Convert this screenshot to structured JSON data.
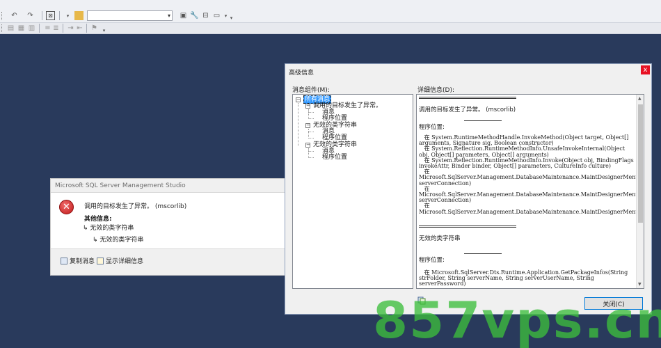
{
  "colors": {
    "background": "#293a5c",
    "error_red": "#c11a1a",
    "selection": "#3399ff",
    "watermark": "#3cbe3c"
  },
  "toolbar": {
    "row1_icons": [
      "undo-icon",
      "redo-icon",
      "find-icon",
      "dropdown-icon",
      "folder-icon",
      "properties-icon",
      "wrench-icon",
      "toolbox-icon",
      "window-icon"
    ],
    "combo_value": "",
    "row2_icons": [
      "comment-icon",
      "uncomment-icon",
      "indent-icon",
      "outdent-icon",
      "bookmark-icon"
    ]
  },
  "msgbox": {
    "title": "Microsoft SQL Server Management Studio",
    "message": "调用的目标发生了异常。 (mscorlib)",
    "other_info_label": "其他信息:",
    "line1": "无效的类字符串",
    "line2": "无效的类字符串",
    "copy_link": "复制消息",
    "details_link": "显示详细信息"
  },
  "advanced": {
    "title": "高级信息",
    "tree_label": "消息组件(M):",
    "detail_label": "详细信息(D):",
    "tree": {
      "root": "所有消息",
      "group1": "调用的目标发生了异常。",
      "group1_msg": "消息",
      "group1_loc": "程序位置",
      "group2": "无效的类字符串",
      "group2_msg": "消息",
      "group2_loc": "程序位置",
      "group3": "无效的类字符串",
      "group3_msg": "消息",
      "group3_loc": "程序位置"
    },
    "detail": {
      "message1": "调用的目标发生了异常。 (mscorlib)",
      "location_label": "程序位置:",
      "stack1": "   在 System.RuntimeMethodHandle.InvokeMethod(Object target, Object[] arguments, Signature sig, Boolean constructor)\n   在 System.Reflection.RuntimeMethodInfo.UnsafeInvokeInternal(Object obj, Object[] parameters, Object[] arguments)\n   在 System.Reflection.RuntimeMethodInfo.Invoke(Object obj, BindingFlags invokeAttr, Binder binder, Object[] parameters, CultureInfo culture)\n   在\nMicrosoft.SqlServer.Management.DatabaseMaintenance.MaintDesignerMenuHandler.GetExistingPackageNames(ServerConnection serverConnection)\n   在\nMicrosoft.SqlServer.Management.DatabaseMaintenance.MaintDesignerMenuHandler.GetNewPackageName(ServerConnection serverConnection)\n   在\nMicrosoft.SqlServer.Management.DatabaseMaintenance.MaintDesignerMenuHandler.Invoke()",
      "message2": "无效的类字符串",
      "location_label2": "程序位置:",
      "stack2": "   在 Microsoft.SqlServer.Dts.Runtime.Application.GetPackageInfos(String strFolder, String serverName, String serverUserName, String serverPassword)"
    },
    "close_button": "关闭(C)"
  },
  "watermark": "857vps.cn"
}
